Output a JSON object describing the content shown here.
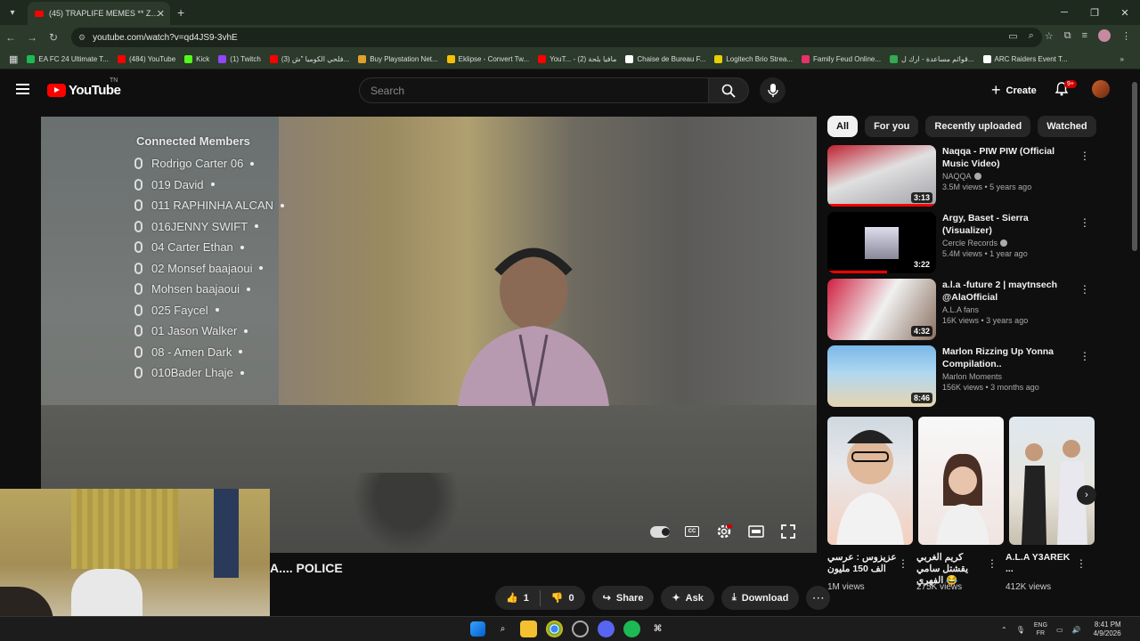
{
  "browser": {
    "tab_title": "(45) TRAPLIFE MEMES ** Z…",
    "url": "youtube.com/watch?v=qd4JS9-3vhE",
    "bookmarks": [
      {
        "label": "EA FC 24 Ultimate T...",
        "color": "#1db954"
      },
      {
        "label": "(484) YouTube",
        "color": "#ff0000"
      },
      {
        "label": "Kick",
        "color": "#53fc18"
      },
      {
        "label": "(1) Twitch",
        "color": "#9146ff"
      },
      {
        "label": "(3) فلحي الكوميا \"ش...",
        "color": "#ff0000"
      },
      {
        "label": "Buy Playstation Net...",
        "color": "#e0a030"
      },
      {
        "label": "Eklipse - Convert Tw...",
        "color": "#f5c000"
      },
      {
        "label": "YouT... - مافيا بلحة (2)",
        "color": "#ff0000"
      },
      {
        "label": "Chaise de Bureau F...",
        "color": "#ffffff"
      },
      {
        "label": "Logitech Brio Strea...",
        "color": "#e8d000"
      },
      {
        "label": "Family Feud Online...",
        "color": "#e8306a"
      },
      {
        "label": "قوائم مساعدة - ارك ل...",
        "color": "#34a853"
      },
      {
        "label": "ARC Raiders Event T...",
        "color": "#ffffff"
      }
    ]
  },
  "header": {
    "logo_text": "YouTube",
    "logo_sup": "TN",
    "search_placeholder": "Search",
    "create_label": "Create",
    "notif_badge": "9+"
  },
  "video": {
    "members_title": "Connected Members",
    "members": [
      "Rodrigo Carter 06",
      "019 David",
      "011 RAPHINHA ALCAN",
      "016JENNY SWIFT",
      "04 Carter Ethan",
      "02 Monsef baajaoui",
      "Mohsen baajaoui",
      "025 Faycel",
      "01 Jason Walker",
      "08 - Amen Dark",
      "010Bader Lhaje"
    ],
    "title": "A.... POLICE",
    "likes": "1",
    "dislikes": "0",
    "share_label": "Share",
    "ask_label": "Ask",
    "download_label": "Download"
  },
  "chips": [
    "All",
    "For you",
    "Recently uploaded",
    "Watched"
  ],
  "recommendations": [
    {
      "title": "Naqqa - PIW PIW (Official Music Video)",
      "channel": "NAQQA",
      "verified": true,
      "meta": "3.5M views • 5 years ago",
      "duration": "3:13",
      "progress": 1.0
    },
    {
      "title": "Argy, Baset - Sierra (Visualizer)",
      "channel": "Cercle Records",
      "verified": true,
      "meta": "5.4M views • 1 year ago",
      "duration": "3:22",
      "progress": 0.55
    },
    {
      "title": "a.l.a -future 2 | maytnsech @AlaOfficial",
      "channel": "A.L.A fans",
      "verified": false,
      "meta": "16K views • 3 years ago",
      "duration": "4:32",
      "progress": 0
    },
    {
      "title": "Marlon Rizzing Up Yonna Compilation..",
      "channel": "Marlon Moments",
      "verified": false,
      "meta": "156K views • 3 months ago",
      "duration": "8:46",
      "progress": 0
    }
  ],
  "shorts": [
    {
      "title": "عزيزوس : عرسي الف 150 مليون",
      "views": "1M views"
    },
    {
      "title": "كريم الغربي يقشتل سامي الفهري 😂",
      "views": "275K views"
    },
    {
      "title": "A.L.A Y3AREK ...",
      "views": "412K views"
    }
  ],
  "taskbar": {
    "lang_top": "ENG",
    "lang_bottom": "FR",
    "time": "8:41 PM",
    "date": "4/9/2026"
  }
}
